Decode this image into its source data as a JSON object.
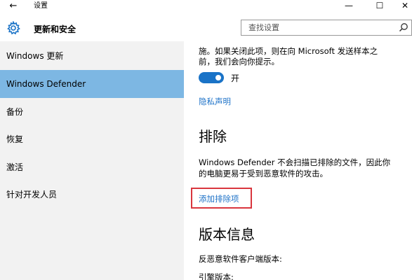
{
  "window": {
    "title": "设置",
    "back_glyph": "←",
    "min_glyph": "—",
    "max_glyph": "☐",
    "close_glyph": "✕"
  },
  "header": {
    "title": "更新和安全",
    "search_placeholder": "查找设置"
  },
  "sidebar": {
    "items": [
      {
        "label": "Windows 更新"
      },
      {
        "label": "Windows Defender",
        "active": true
      },
      {
        "label": "备份"
      },
      {
        "label": "恢复"
      },
      {
        "label": "激活"
      },
      {
        "label": "针对开发人员"
      }
    ]
  },
  "content": {
    "sample_desc_line1": "施。如果关闭此项，则在向 Microsoft 发送样本之",
    "sample_desc_line2": "前，我们会向你提示。",
    "toggle": {
      "state": "on",
      "label": "开"
    },
    "privacy_link": "隐私声明",
    "exclusions_heading": "排除",
    "exclusions_desc_line1": "Windows Defender 不会扫描已排除的文件，因此你",
    "exclusions_desc_line2": "的电脑更易于受到恶意软件的攻击。",
    "add_exclusion_link": "添加排除项",
    "version_heading": "版本信息",
    "version_client": "反恶意软件客户端版本:",
    "version_engine": "引擎版本:"
  },
  "colors": {
    "accent": "#1a73c7",
    "link": "#1f73c8",
    "sidebar_bg": "#f2f2f2",
    "sidebar_active": "#7db7e3",
    "highlight_border": "#d9363e"
  }
}
